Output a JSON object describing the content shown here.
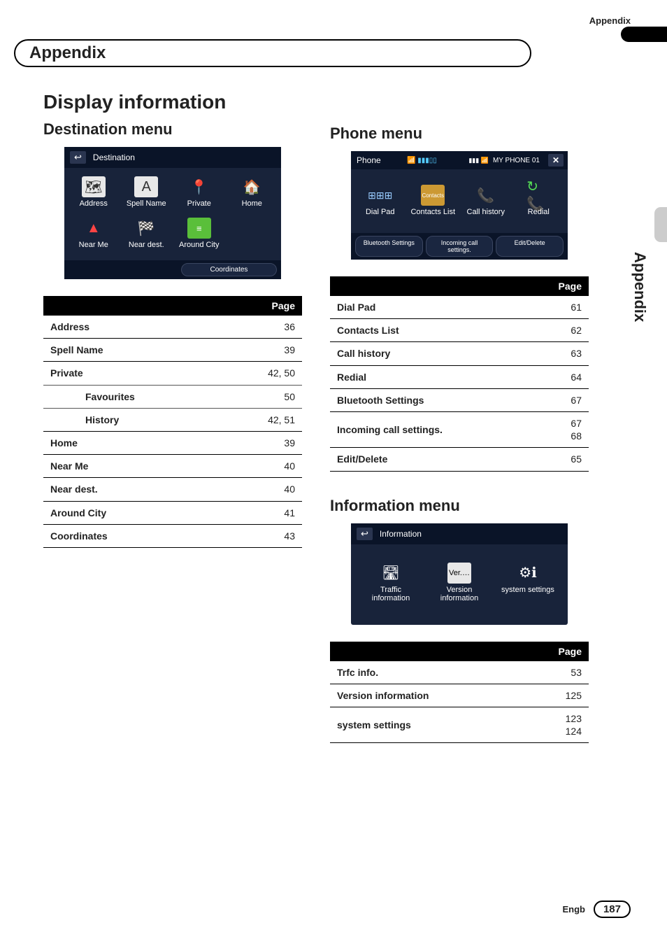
{
  "header": {
    "section": "Appendix"
  },
  "chapter": "Appendix",
  "side_label": "Appendix",
  "title": "Display information",
  "destination_menu": {
    "heading": "Destination menu",
    "screen": {
      "title": "Destination",
      "items": [
        {
          "label": "Address"
        },
        {
          "label": "Spell Name"
        },
        {
          "label": "Private"
        },
        {
          "label": "Home"
        },
        {
          "label": "Near Me"
        },
        {
          "label": "Near dest."
        },
        {
          "label": "Around City"
        }
      ],
      "coordinates_btn": "Coordinates"
    },
    "table_header": "Page",
    "rows": [
      {
        "label": "Address",
        "page": "36"
      },
      {
        "label": "Spell Name",
        "page": "39"
      },
      {
        "label": "Private",
        "page": "42, 50"
      },
      {
        "label": "Favourites",
        "page": "50",
        "indent": true
      },
      {
        "label": "History",
        "page": "42, 51",
        "indent": true
      },
      {
        "label": "Home",
        "page": "39"
      },
      {
        "label": "Near Me",
        "page": "40"
      },
      {
        "label": "Near dest.",
        "page": "40"
      },
      {
        "label": "Around City",
        "page": "41"
      },
      {
        "label": "Coordinates",
        "page": "43"
      }
    ]
  },
  "phone_menu": {
    "heading": "Phone menu",
    "screen": {
      "title": "Phone",
      "device": "MY PHONE 01",
      "items": [
        {
          "label": "Dial Pad"
        },
        {
          "label": "Contacts List"
        },
        {
          "label": "Call history"
        },
        {
          "label": "Redial"
        }
      ],
      "buttons": [
        "Bluetooth Settings",
        "Incoming call settings.",
        "Edit/Delete"
      ]
    },
    "table_header": "Page",
    "rows": [
      {
        "label": "Dial Pad",
        "page": "61"
      },
      {
        "label": "Contacts List",
        "page": "62"
      },
      {
        "label": "Call history",
        "page": "63"
      },
      {
        "label": "Redial",
        "page": "64"
      },
      {
        "label": "Bluetooth Settings",
        "page": "67"
      },
      {
        "label": "Incoming call settings.",
        "page": "67\n68"
      },
      {
        "label": "Edit/Delete",
        "page": "65"
      }
    ]
  },
  "info_menu": {
    "heading": "Information menu",
    "screen": {
      "title": "Information",
      "items": [
        {
          "label": "Traffic\ninformation"
        },
        {
          "label": "Version\ninformation",
          "badge": "Ver.…"
        },
        {
          "label": "system settings"
        }
      ]
    },
    "table_header": "Page",
    "rows": [
      {
        "label": "Trfc info.",
        "page": "53"
      },
      {
        "label": "Version information",
        "page": "125"
      },
      {
        "label": "system settings",
        "page": "123\n124"
      }
    ]
  },
  "footer": {
    "lang": "Engb",
    "page": "187"
  }
}
